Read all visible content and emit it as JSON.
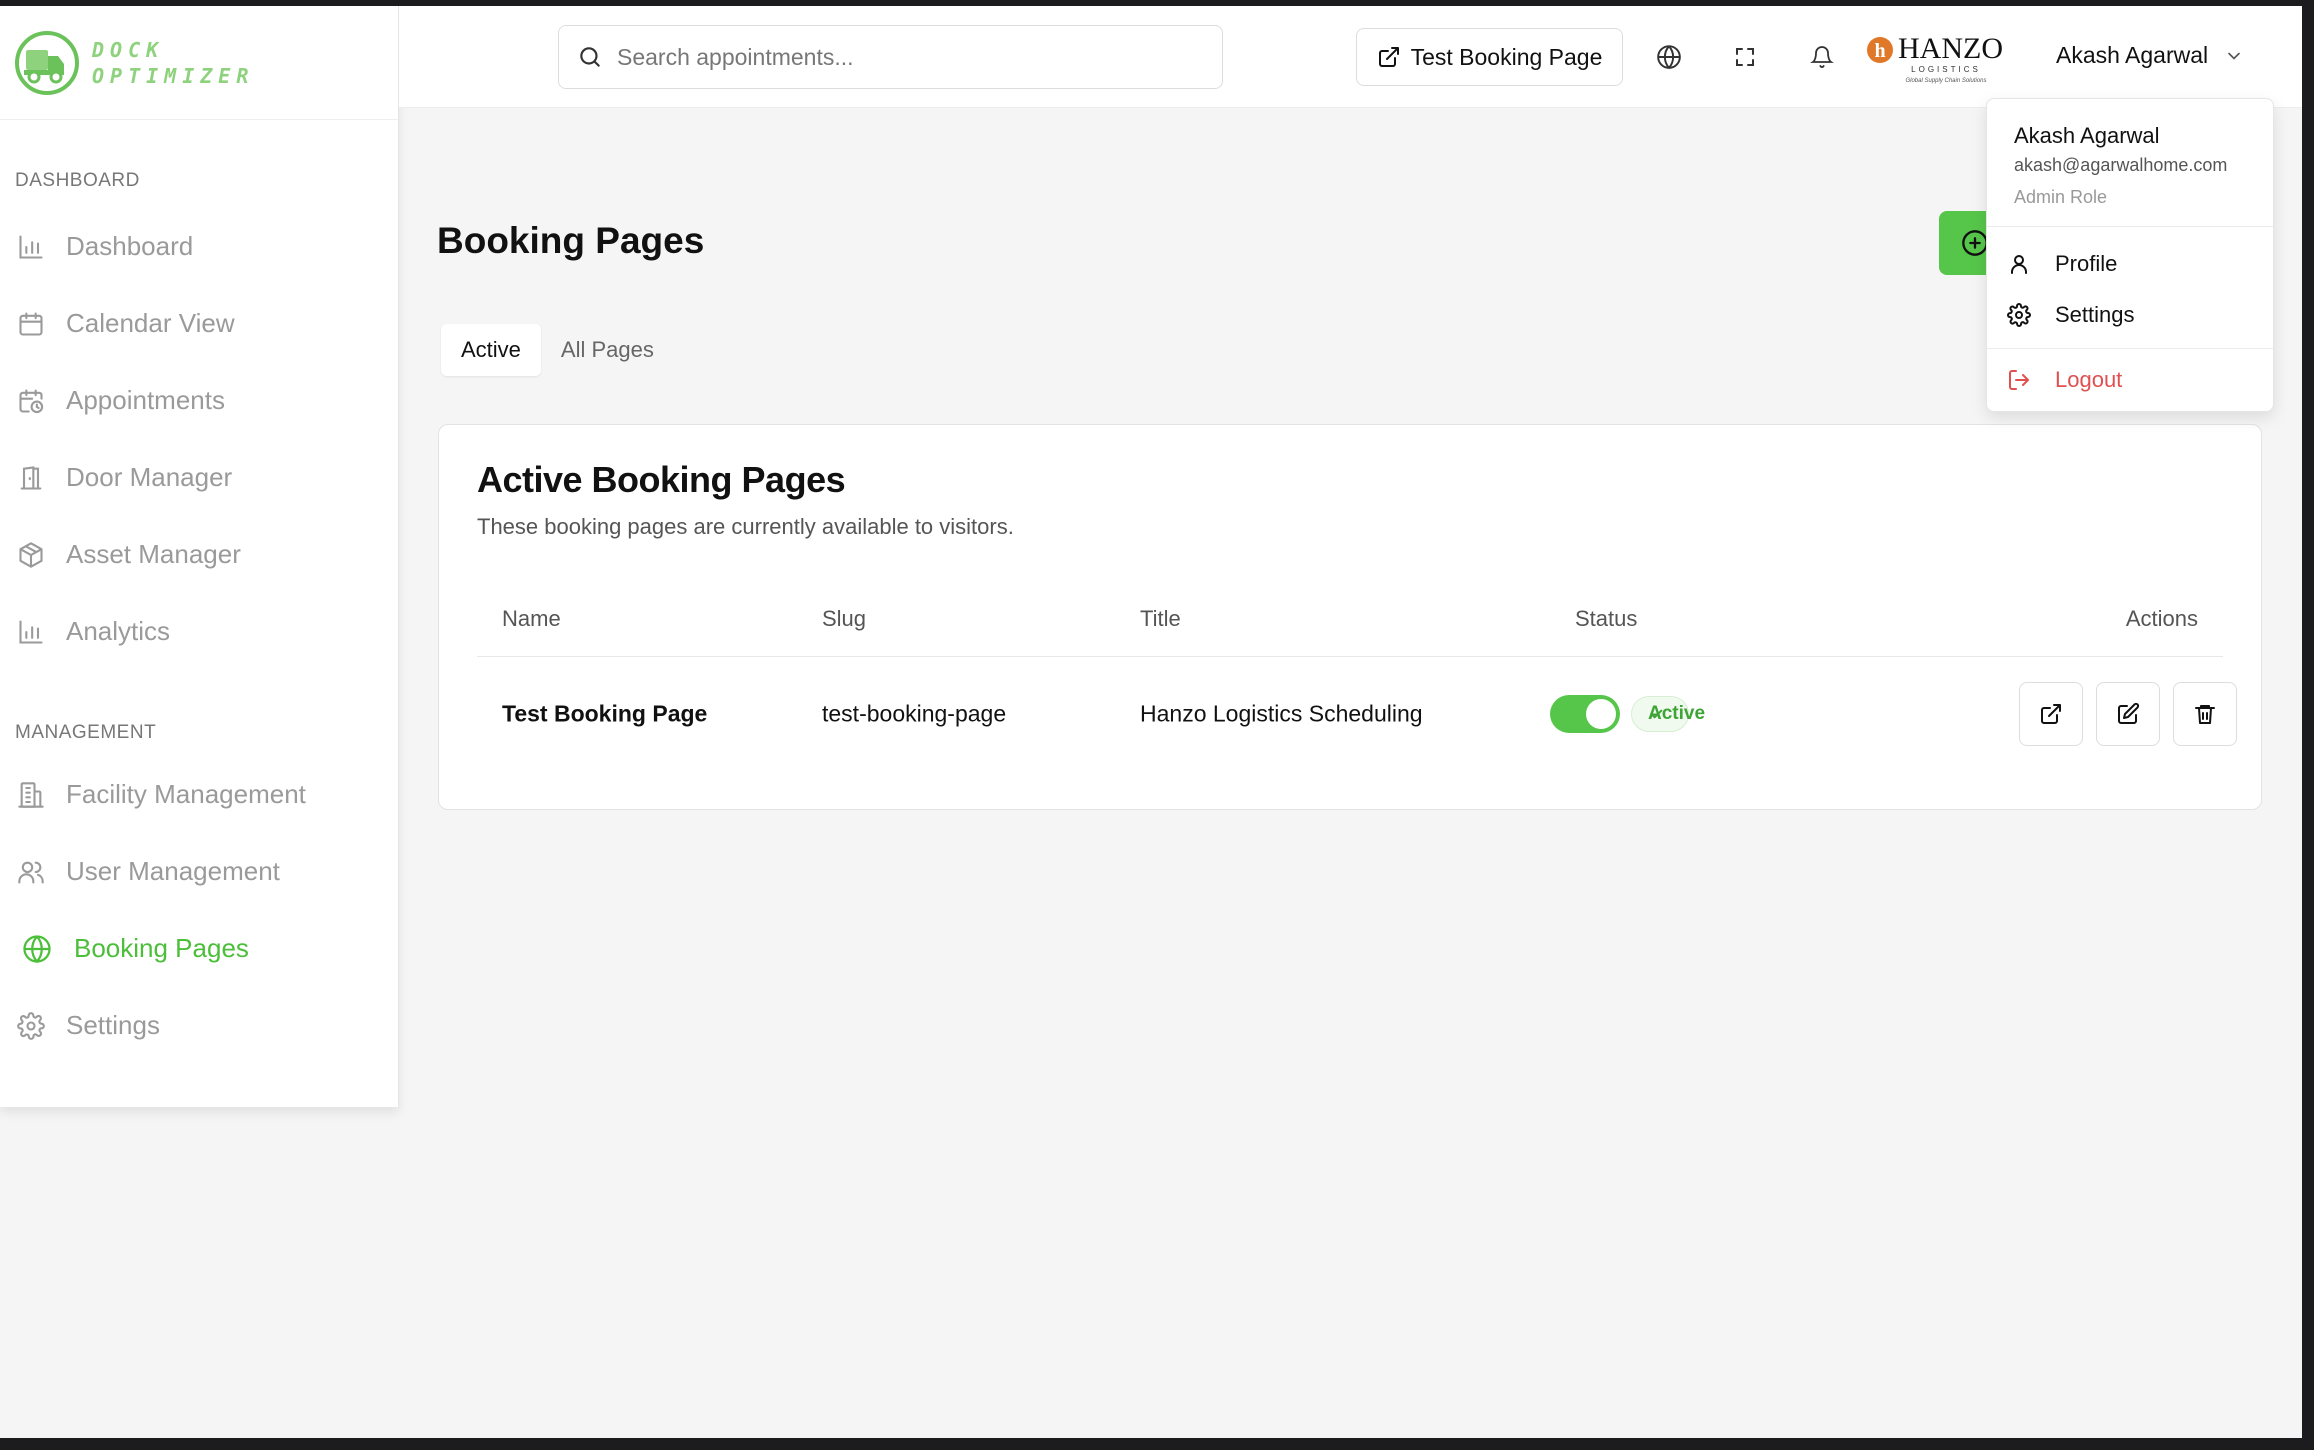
{
  "app": {
    "name_line1": "DOCK",
    "name_line2": "OPTIMIZER"
  },
  "header": {
    "search_placeholder": "Search appointments...",
    "test_booking_label": "Test Booking Page",
    "brand_name": "HANZO",
    "brand_sub": "LOGISTICS",
    "brand_tagline": "Global Supply Chain Solutions",
    "user_name": "Akash Agarwal"
  },
  "sidebar": {
    "sections": [
      {
        "label": "DASHBOARD",
        "items": [
          {
            "label": "Dashboard",
            "icon": "bar-chart-icon"
          },
          {
            "label": "Calendar View",
            "icon": "calendar-icon"
          },
          {
            "label": "Appointments",
            "icon": "calendar-clock-icon"
          },
          {
            "label": "Door Manager",
            "icon": "door-icon"
          },
          {
            "label": "Asset Manager",
            "icon": "package-icon"
          },
          {
            "label": "Analytics",
            "icon": "bar-chart-icon"
          }
        ]
      },
      {
        "label": "MANAGEMENT",
        "items": [
          {
            "label": "Facility Management",
            "icon": "building-icon"
          },
          {
            "label": "User Management",
            "icon": "users-icon"
          },
          {
            "label": "Booking Pages",
            "icon": "globe-icon",
            "active": true
          },
          {
            "label": "Settings",
            "icon": "gear-icon"
          }
        ]
      }
    ]
  },
  "main": {
    "title": "Booking Pages",
    "tabs": [
      {
        "label": "Active",
        "active": true
      },
      {
        "label": "All Pages",
        "active": false
      }
    ],
    "card": {
      "title": "Active Booking Pages",
      "subtitle": "These booking pages are currently available to visitors.",
      "columns": [
        "Name",
        "Slug",
        "Title",
        "Status",
        "Actions"
      ],
      "rows": [
        {
          "name": "Test Booking Page",
          "slug": "test-booking-page",
          "title": "Hanzo Logistics Scheduling",
          "status": "Active",
          "enabled": true
        }
      ]
    }
  },
  "user_menu": {
    "name": "Akash Agarwal",
    "email": "akash@agarwalhome.com",
    "role": "Admin Role",
    "items": [
      {
        "label": "Profile",
        "icon": "user-icon"
      },
      {
        "label": "Settings",
        "icon": "gear-icon"
      },
      {
        "label": "Logout",
        "icon": "logout-icon"
      }
    ]
  },
  "colors": {
    "accent": "#56c64a",
    "accent_text": "#4cbf3a",
    "danger": "#e05050",
    "brand_orange": "#e0782a"
  }
}
